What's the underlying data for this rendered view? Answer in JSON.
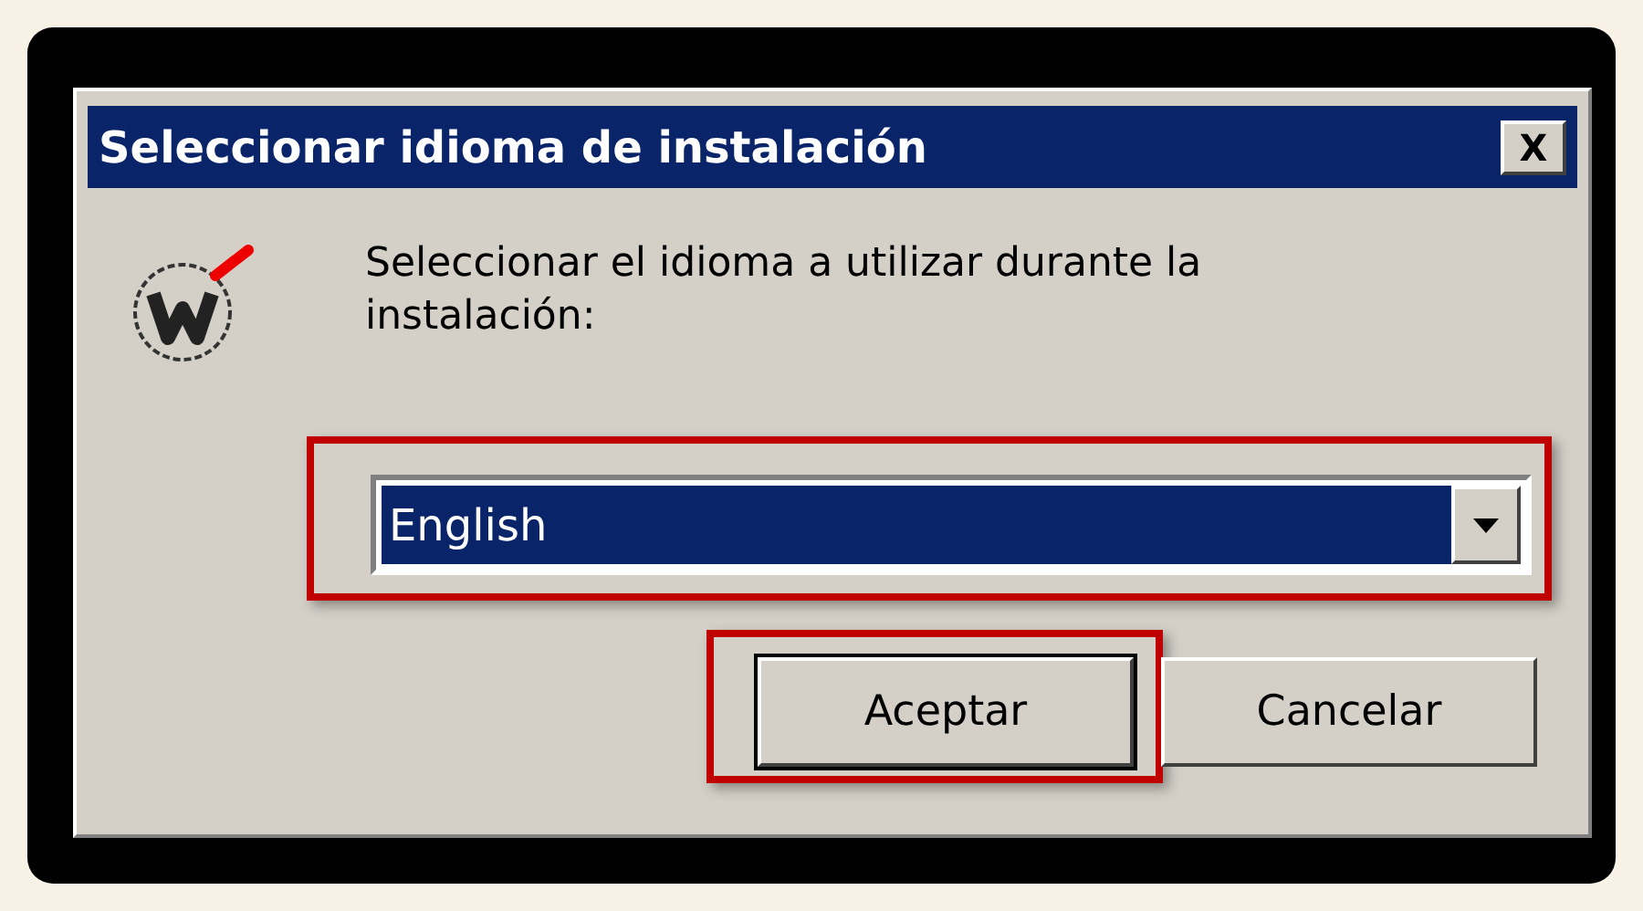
{
  "window": {
    "title": "Seleccionar idioma de instalación",
    "close_label": "X"
  },
  "prompt": "Seleccionar el idioma a utilizar durante la instalación:",
  "language_select": {
    "value": "English",
    "highlighted": true
  },
  "buttons": [
    {
      "label": "Aceptar",
      "default": true,
      "highlighted": true
    },
    {
      "label": "Cancelar",
      "default": false,
      "highlighted": false
    }
  ]
}
